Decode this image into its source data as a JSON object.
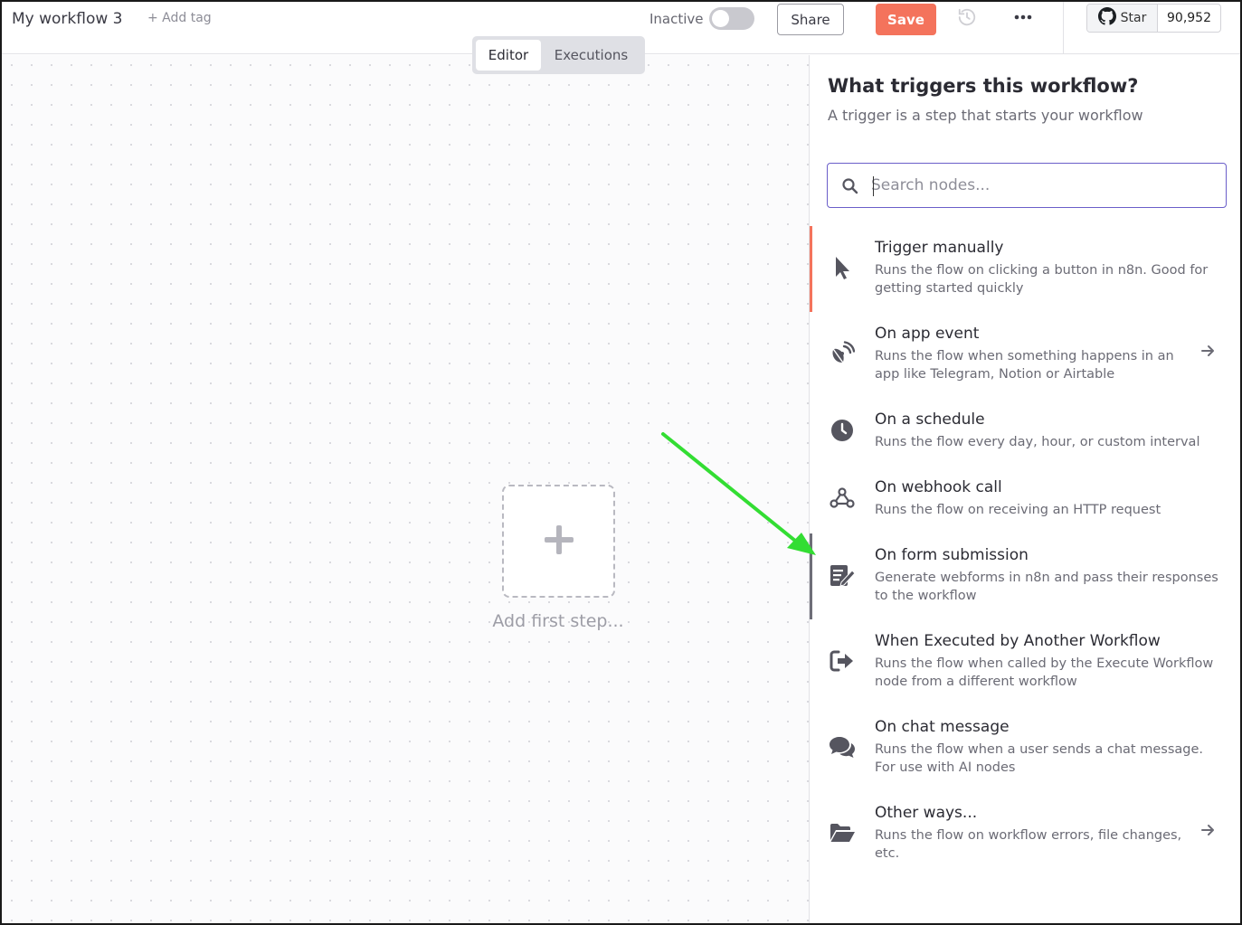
{
  "header": {
    "workflow_name": "My workflow 3",
    "add_tag": "+ Add tag",
    "active_label": "Inactive",
    "active": false,
    "share_label": "Share",
    "save_label": "Save",
    "github": {
      "star_label": "Star",
      "count": "90,952"
    }
  },
  "tabs": [
    {
      "label": "Editor",
      "active": true
    },
    {
      "label": "Executions",
      "active": false
    }
  ],
  "canvas": {
    "add_first_step": "Add first step..."
  },
  "panel": {
    "title": "What triggers this workflow?",
    "subtitle": "A trigger is a step that starts your workflow",
    "search": {
      "placeholder": "Search nodes...",
      "value": ""
    },
    "items": [
      {
        "title": "Trigger manually",
        "description": "Runs the flow on clicking a button in n8n. Good for getting started quickly",
        "icon": "cursor-icon",
        "has_arrow": false
      },
      {
        "title": "On app event",
        "description": "Runs the flow when something happens in an app like Telegram, Notion or Airtable",
        "icon": "satellite-dish-icon",
        "has_arrow": true
      },
      {
        "title": "On a schedule",
        "description": "Runs the flow every day, hour, or custom interval",
        "icon": "clock-icon",
        "has_arrow": false
      },
      {
        "title": "On webhook call",
        "description": "Runs the flow on receiving an HTTP request",
        "icon": "webhook-icon",
        "has_arrow": false
      },
      {
        "title": "On form submission",
        "description": "Generate webforms in n8n and pass their responses to the workflow",
        "icon": "form-icon",
        "has_arrow": false
      },
      {
        "title": "When Executed by Another Workflow",
        "description": "Runs the flow when called by the Execute Workflow node from a different workflow",
        "icon": "sign-out-icon",
        "has_arrow": false
      },
      {
        "title": "On chat message",
        "description": "Runs the flow when a user sends a chat message. For use with AI nodes",
        "icon": "comments-icon",
        "has_arrow": false
      },
      {
        "title": "Other ways...",
        "description": "Runs the flow on workflow errors, file changes, etc.",
        "icon": "folder-open-icon",
        "has_arrow": true
      }
    ]
  },
  "colors": {
    "accent": "#f4735c",
    "search_border": "#6a5ec9",
    "annotation_arrow": "#33dd33"
  }
}
